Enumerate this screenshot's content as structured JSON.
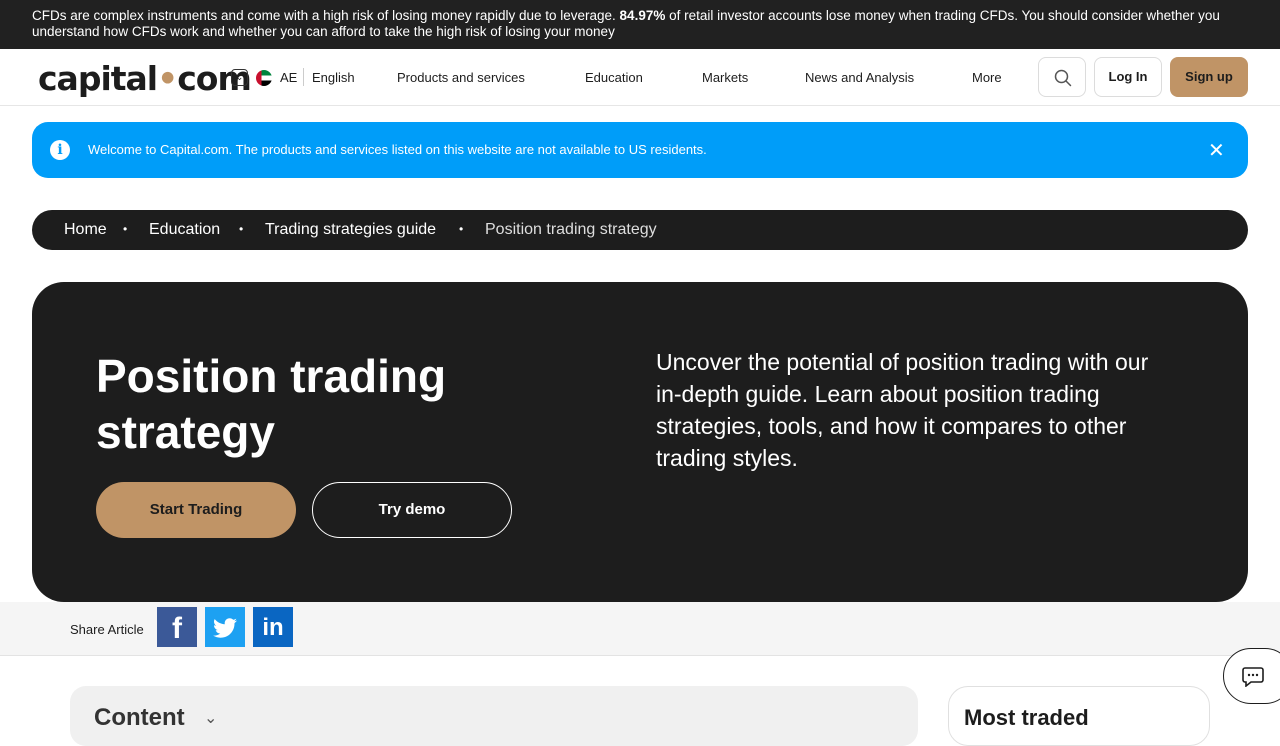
{
  "risk_banner": {
    "text_before": "CFDs are complex instruments and come with a high risk of losing money rapidly due to leverage.",
    "percent": "84.97%",
    "text_after": "of retail investor accounts lose money when trading CFDs. You should consider whether you understand how CFDs work and whether you can afford to take the high risk of losing your money"
  },
  "header": {
    "logo_left": "capital",
    "logo_dot": "•",
    "logo_right": "com",
    "region": "AE",
    "language": "English",
    "nav": [
      "Products and services",
      "Education",
      "Markets",
      "News and Analysis",
      "More"
    ],
    "login": "Log In",
    "signup": "Sign up"
  },
  "notice": {
    "message": "Welcome to Capital.com. The products and services listed on this website are not available to US residents.",
    "close": "✕"
  },
  "breadcrumb": {
    "items": [
      "Home",
      "Education",
      "Trading strategies guide"
    ],
    "current": "Position trading strategy",
    "separator": "•"
  },
  "hero": {
    "title": "Position trading strategy",
    "lead": "Uncover the potential of position trading with our in-depth guide. Learn about position trading strategies, tools, and how it compares to other trading styles.",
    "cta_primary": "Start Trading",
    "cta_secondary": "Try demo"
  },
  "share": {
    "label": "Share Article",
    "facebook": "f",
    "linkedin": "in"
  },
  "content": {
    "title": "Content"
  },
  "most_traded": {
    "title": "Most traded"
  },
  "colors": {
    "accent": "#c09466",
    "notice": "#009df9",
    "dark": "#1d1d1d"
  }
}
